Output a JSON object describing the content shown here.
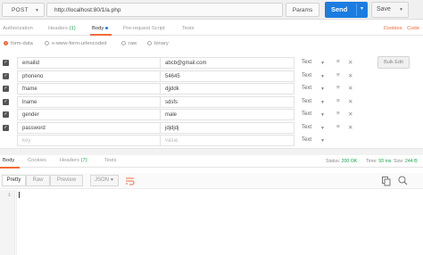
{
  "request": {
    "method": "POST",
    "url": "http://localhost:80/1/a.php",
    "params_label": "Params",
    "send_label": "Send",
    "save_label": "Save"
  },
  "request_tabs": [
    {
      "label": "Authorization"
    },
    {
      "label": "Headers",
      "count": "(1)"
    },
    {
      "label": "Body",
      "active": true
    },
    {
      "label": "Pre-request Script"
    },
    {
      "label": "Tests"
    }
  ],
  "cookies_link": "Cookies",
  "code_link": "Code",
  "body_modes": [
    {
      "label": "form-data",
      "selected": true
    },
    {
      "label": "x-www-form-urlencoded",
      "selected": false
    },
    {
      "label": "raw",
      "selected": false
    },
    {
      "label": "binary",
      "selected": false
    }
  ],
  "form_rows": [
    {
      "key": "emailid",
      "value": "abcb@gmail.com",
      "type": "Text"
    },
    {
      "key": "phoneno",
      "value": "54645",
      "type": "Text"
    },
    {
      "key": "fname",
      "value": "djjddk",
      "type": "Text"
    },
    {
      "key": "lname",
      "value": "sdsfs",
      "type": "Text"
    },
    {
      "key": "gender",
      "value": "male",
      "type": "Text"
    },
    {
      "key": "password",
      "value": "jdjdjdj",
      "type": "Text"
    }
  ],
  "new_row": {
    "key_placeholder": "key",
    "value_placeholder": "value",
    "type": "Text"
  },
  "bulk_edit_label": "Bulk Edit",
  "response_tabs": [
    {
      "label": "Body",
      "active": true
    },
    {
      "label": "Cookies"
    },
    {
      "label": "Headers",
      "count": "(7)"
    },
    {
      "label": "Tests"
    }
  ],
  "status": {
    "status_label": "Status:",
    "status_value": "200 OK",
    "time_label": "Time:",
    "time_value": "93 ms",
    "size_label": "Size:",
    "size_value": "244 B"
  },
  "view_modes": {
    "pretty": "Pretty",
    "raw": "Raw",
    "preview": "Preview",
    "format": "JSON"
  },
  "editor": {
    "line_number": "1"
  },
  "colors": {
    "accent": "#f26b3a",
    "send": "#1b7ce1",
    "ok": "#18a44a"
  }
}
